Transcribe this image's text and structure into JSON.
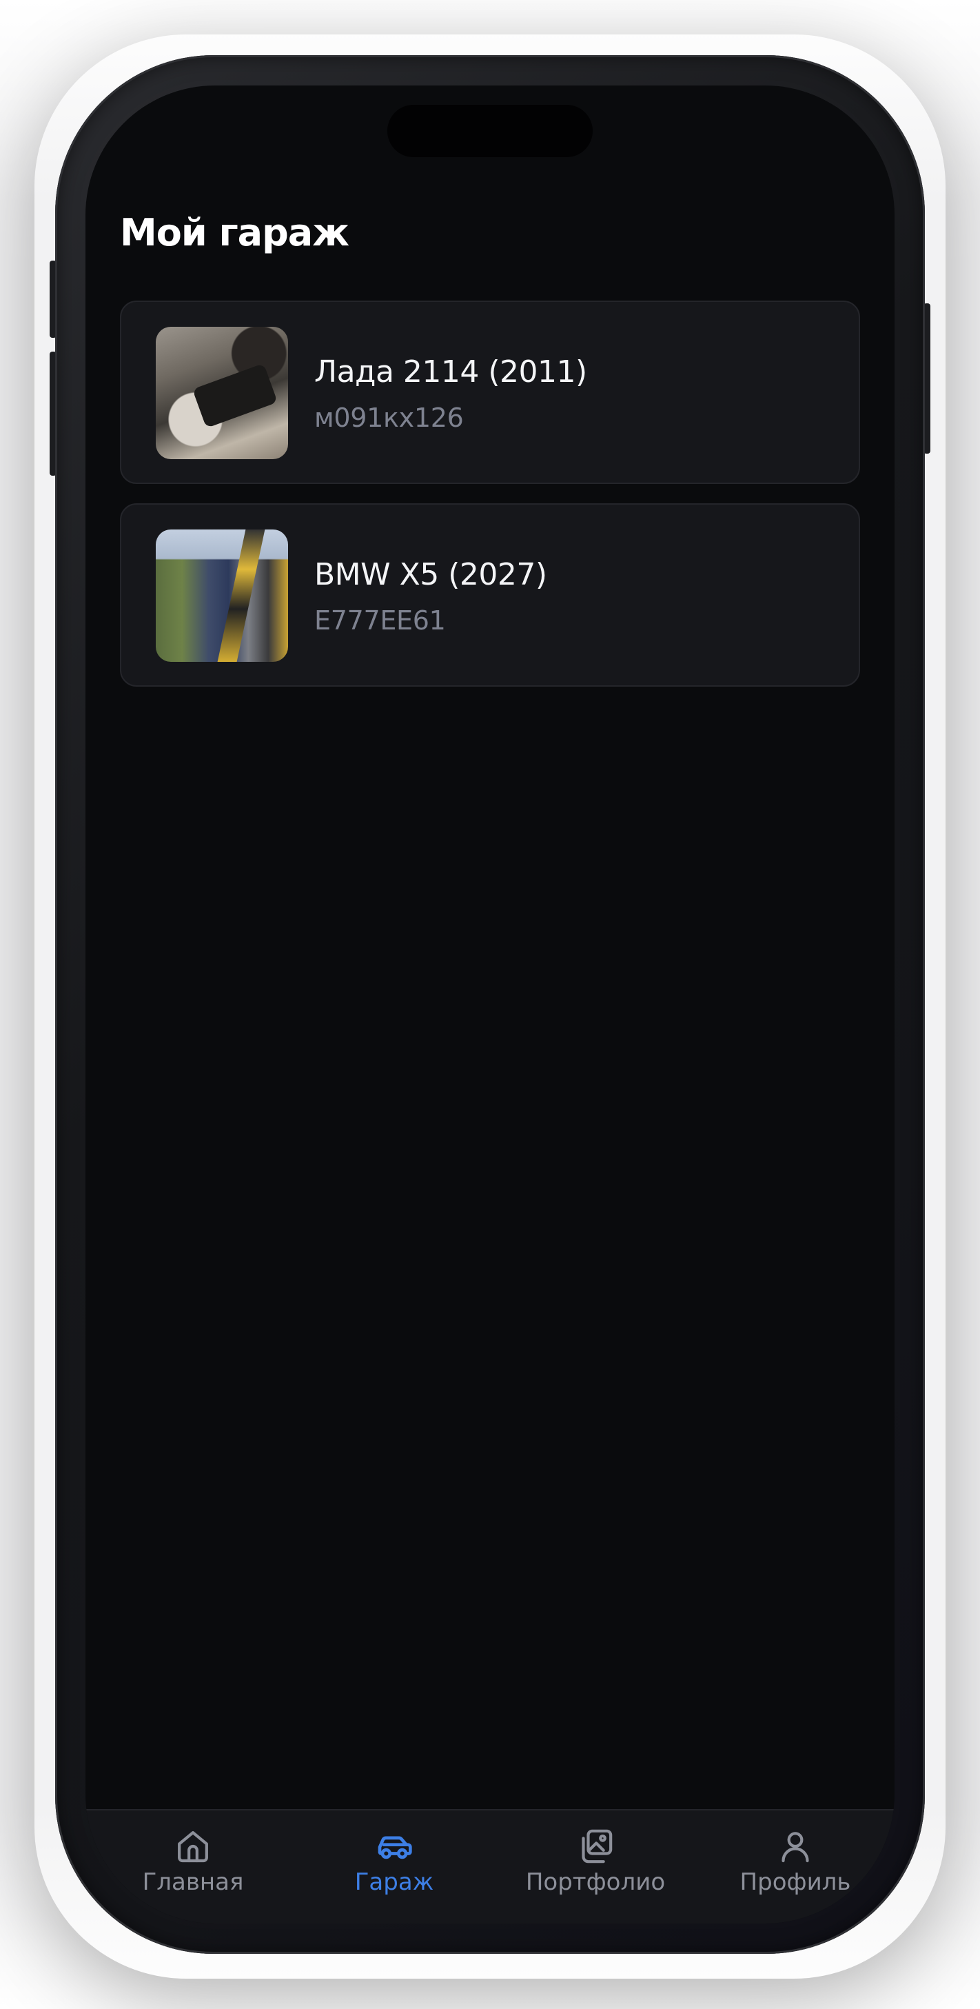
{
  "screen": {
    "title": "Мой гараж"
  },
  "cars": [
    {
      "name": "Лада 2114 (2011)",
      "plate": "м091кх126"
    },
    {
      "name": "BMW X5 (2027)",
      "plate": "E777EE61"
    }
  ],
  "tab_bar": {
    "active": "garage",
    "accent_color": "#3d7fe6",
    "inactive_color": "#8d909a",
    "tabs": [
      {
        "id": "home",
        "label": "Главная",
        "icon": "home-icon"
      },
      {
        "id": "garage",
        "label": "Гараж",
        "icon": "car-icon"
      },
      {
        "id": "portfolio",
        "label": "Портфолио",
        "icon": "gallery-icon"
      },
      {
        "id": "profile",
        "label": "Профиль",
        "icon": "user-icon"
      }
    ]
  }
}
